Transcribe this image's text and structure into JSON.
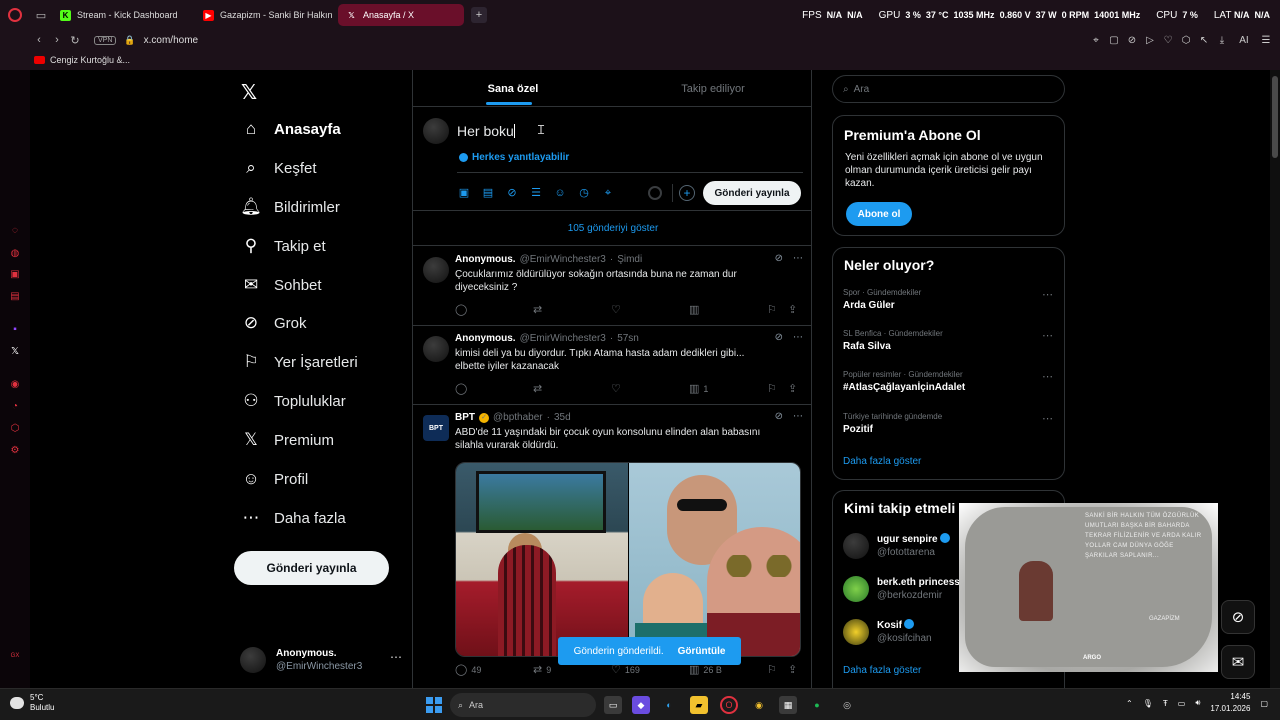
{
  "browser": {
    "tabs": [
      {
        "title": "Stream - Kick Dashboard",
        "icon": "kick-icon",
        "color": "#53fc18",
        "active": false
      },
      {
        "title": "Gazapizm - Sanki Bir Halkın",
        "icon": "youtube-icon",
        "color": "#ff0000",
        "active": false
      },
      {
        "title": "Anasayfa / X",
        "icon": "x-logo-icon",
        "color": "#ffffff",
        "active": true
      }
    ],
    "new_tab": "+",
    "vpn": "VPN",
    "url": "x.com/home",
    "bookmark": "Cengiz Kurtoğlu &...",
    "stats": {
      "fps_label": "FPS",
      "fps_1": "N/A",
      "fps_2": "N/A",
      "gpu_label": "GPU",
      "gpu_load": "3 %",
      "gpu_temp": "37 °C",
      "gpu_clock": "1035 MHz",
      "gpu_volt": "0.860 V",
      "gpu_power": "37 W",
      "gpu_fan": "0 RPM",
      "gpu_mem": "14001 MHz",
      "cpu_label": "CPU",
      "cpu_load": "7 %",
      "lat_label": "LAT",
      "lat_1": "N/A",
      "lat_2": "N/A"
    },
    "ai_label": "AI"
  },
  "nav": {
    "items": [
      {
        "label": "Anasayfa",
        "icon": "home-icon",
        "active": true
      },
      {
        "label": "Keşfet",
        "icon": "search-icon"
      },
      {
        "label": "Bildirimler",
        "icon": "bell-icon"
      },
      {
        "label": "Takip et",
        "icon": "follow-icon"
      },
      {
        "label": "Sohbet",
        "icon": "mail-icon"
      },
      {
        "label": "Grok",
        "icon": "grok-icon"
      },
      {
        "label": "Yer İşaretleri",
        "icon": "bookmark-icon"
      },
      {
        "label": "Topluluklar",
        "icon": "communities-icon"
      },
      {
        "label": "Premium",
        "icon": "x-logo-icon"
      },
      {
        "label": "Profil",
        "icon": "profile-icon"
      },
      {
        "label": "Daha fazla",
        "icon": "more-icon"
      }
    ],
    "post_button": "Gönderi yayınla",
    "account": {
      "name": "Anonymous.",
      "handle": "@EmirWinchester3"
    }
  },
  "main": {
    "tabs": [
      {
        "label": "Sana özel",
        "active": true
      },
      {
        "label": "Takip ediliyor",
        "active": false
      }
    ],
    "composer": {
      "text": "Her boku",
      "reply_setting": "Herkes yanıtlayabilir",
      "tools": [
        "image-icon",
        "gif-icon",
        "grok-icon",
        "poll-icon",
        "emoji-icon",
        "schedule-icon",
        "location-icon"
      ],
      "publish": "Gönderi yayınla"
    },
    "show_new": "105 gönderiyi göster",
    "tweets": [
      {
        "name": "Anonymous.",
        "handle": "@EmirWinchester3",
        "time": "Şimdi",
        "body": "Çocuklarımız öldürülüyor sokağın ortasında buna ne zaman dur diyeceksiniz ?",
        "views": ""
      },
      {
        "name": "Anonymous.",
        "handle": "@EmirWinchester3",
        "time": "57sn",
        "body": "kimisi deli ya bu diyordur. Tıpkı Atama hasta adam dedikleri gibi... elbette iyiler kazanacak",
        "views": "1"
      },
      {
        "name": "BPT",
        "handle": "@bpthaber",
        "time": "35d",
        "avatar_text": "BPT",
        "body": "ABD'de 11 yaşındaki bir çocuk oyun konsolunu elinden alan babasını silahla vurarak öldürdü.",
        "replies": "49",
        "reposts": "9",
        "likes": "169",
        "views": "26 B"
      }
    ],
    "toast": {
      "text": "Gönderin gönderildi.",
      "action": "Görüntüle"
    }
  },
  "sidebar": {
    "search_placeholder": "Ara",
    "premium": {
      "title": "Premium'a Abone Ol",
      "text": "Yeni özellikleri açmak için abone ol ve uygun olman durumunda içerik üreticisi gelir payı kazan.",
      "button": "Abone ol"
    },
    "trends_title": "Neler oluyor?",
    "trends": [
      {
        "category": "Spor · Gündemdekiler",
        "name": "Arda Güler"
      },
      {
        "category": "SL Benfica · Gündemdekiler",
        "name": "Rafa Silva"
      },
      {
        "category": "Popüler resimler · Gündemdekiler",
        "name": "#AtlasÇağlayanİçinAdalet"
      },
      {
        "category": "Türkiye tarihinde gündemde",
        "name": "Pozitif"
      }
    ],
    "trends_more": "Daha fazla göster",
    "follow_title": "Kimi takip etmeli",
    "follow": [
      {
        "name": "ugur senpire",
        "handle": "@fotottarena",
        "verified": true
      },
      {
        "name": "berk.eth princess",
        "handle": "@berkozdemir",
        "verified": false
      },
      {
        "name": "Kosif",
        "handle": "@kosifcihan",
        "verified": true
      }
    ],
    "follow_more": "Daha fazla göster"
  },
  "video_overlay": {
    "verse": "SANKİ BİR HALKIN TÜM ÖZGÜRLÜK UMUTLARI BAŞKA BİR BAHARDA TEKRAR FİLİZLENİR VE ARDA KALIR YOLLAR CAM DÜNYA GÖĞE ŞARKILAR SAPLANIR...",
    "signature": "GAZAPİZM",
    "logo": "ARGO"
  },
  "taskbar": {
    "weather_temp": "5°C",
    "weather_text": "Bulutlu",
    "search": "Ara",
    "time": "14:45",
    "date": "17.01.2026"
  },
  "colors": {
    "accent": "#1d9bf0",
    "background": "#000000",
    "border": "#2f3336",
    "opera_red": "#e0313f"
  }
}
